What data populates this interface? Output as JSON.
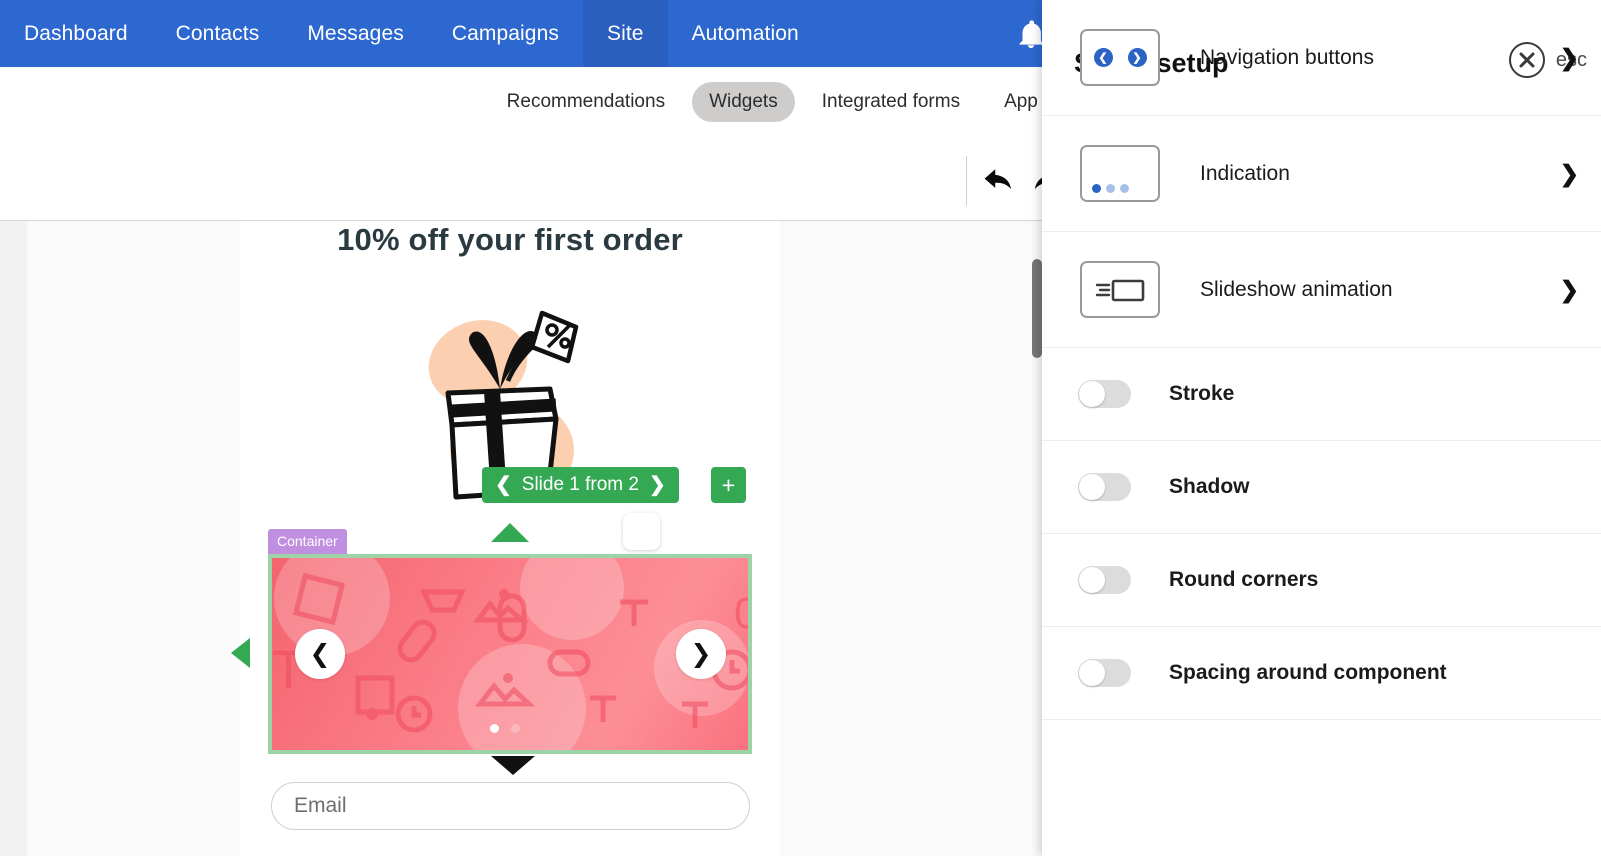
{
  "topnav": {
    "items": [
      {
        "label": "Dashboard",
        "active": false
      },
      {
        "label": "Contacts",
        "active": false
      },
      {
        "label": "Messages",
        "active": false
      },
      {
        "label": "Campaigns",
        "active": false
      },
      {
        "label": "Site",
        "active": true
      },
      {
        "label": "Automation",
        "active": false
      }
    ],
    "bell_icon": "bell-icon"
  },
  "subnav": {
    "items": [
      {
        "label": "Recommendations",
        "active": false
      },
      {
        "label": "Widgets",
        "active": true
      },
      {
        "label": "Integrated forms",
        "active": false
      },
      {
        "label": "App In",
        "active": false
      }
    ]
  },
  "toolbar": {
    "undo_icon": "undo-arrow-icon",
    "redo_icon": "redo-arrow-icon"
  },
  "canvas": {
    "headline": "10% off your first order",
    "illustration": "gift-box-with-discount-tag-icon",
    "slide_control": {
      "prev_icon": "chevron-left-icon",
      "label": "Slide 1 from 2",
      "next_icon": "chevron-right-icon",
      "add_label": "+"
    },
    "container_badge": "Container",
    "slider": {
      "prev_icon": "chevron-left-icon",
      "next_icon": "chevron-right-icon",
      "dots": [
        {
          "active": true
        },
        {
          "active": false
        }
      ]
    },
    "email_placeholder": "Email"
  },
  "panel": {
    "title": "Slider setup",
    "close_icon": "close-circle-icon",
    "esc_label": "esc",
    "nav_rows": [
      {
        "label": "Navigation buttons",
        "icon": "nav-buttons-thumb-icon",
        "chevron": "chevron-right-icon"
      },
      {
        "label": "Indication",
        "icon": "indication-dots-thumb-icon",
        "chevron": "chevron-right-icon"
      },
      {
        "label": "Slideshow animation",
        "icon": "slideshow-animation-thumb-icon",
        "chevron": "chevron-right-icon"
      }
    ],
    "toggle_rows": [
      {
        "label": "Stroke",
        "on": false
      },
      {
        "label": "Shadow",
        "on": false
      },
      {
        "label": "Round corners",
        "on": false
      },
      {
        "label": "Spacing around component",
        "on": false
      }
    ]
  },
  "colors": {
    "nav_blue": "#2d68d0",
    "nav_blue_active": "#2a5fc0",
    "green": "#34a853",
    "purple_badge": "#c08fe0",
    "slider_pink": "#fa7d88",
    "accent_blue": "#2a63c4"
  }
}
